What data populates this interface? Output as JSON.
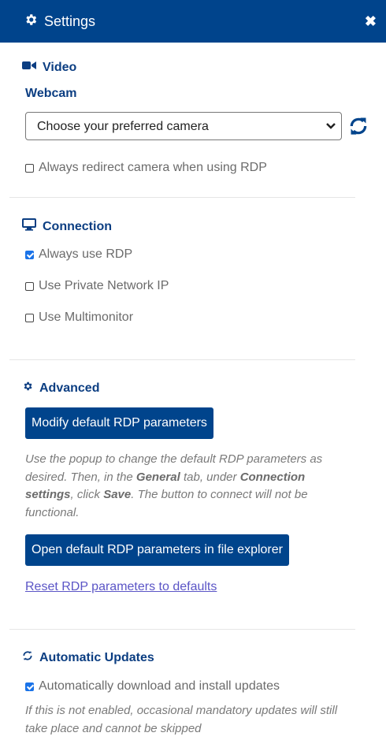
{
  "header": {
    "title": "Settings"
  },
  "video": {
    "title": "Video",
    "webcam_label": "Webcam",
    "select": {
      "selected": "Choose your preferred camera"
    },
    "redirect_label": "Always redirect camera when using RDP"
  },
  "connection": {
    "title": "Connection",
    "options": [
      {
        "label": "Always use RDP",
        "checked": true
      },
      {
        "label": "Use Private Network IP",
        "checked": false
      },
      {
        "label": "Use Multimonitor",
        "checked": false
      }
    ]
  },
  "advanced": {
    "title": "Advanced",
    "modify_button": "Modify default RDP parameters",
    "note": {
      "p1": "Use the popup to change the default RDP parameters as desired. Then, in the ",
      "b1": "General",
      "p2": " tab, under ",
      "b2": "Connection settings",
      "p3": ", click ",
      "b3": "Save",
      "p4": ". The button to connect will not be functional."
    },
    "open_button": "Open default RDP parameters in file explorer",
    "reset_link": "Reset RDP parameters to defaults"
  },
  "updates": {
    "title": "Automatic Updates",
    "auto_label": "Automatically download and install updates",
    "auto_checked": true,
    "note": "If this is not enabled, occasional mandatory updates will still take place and cannot be skipped"
  },
  "colors": {
    "brand": "#00448c",
    "heading": "#0c3e82",
    "link": "#5b55c6",
    "check": "#1a73e8"
  }
}
